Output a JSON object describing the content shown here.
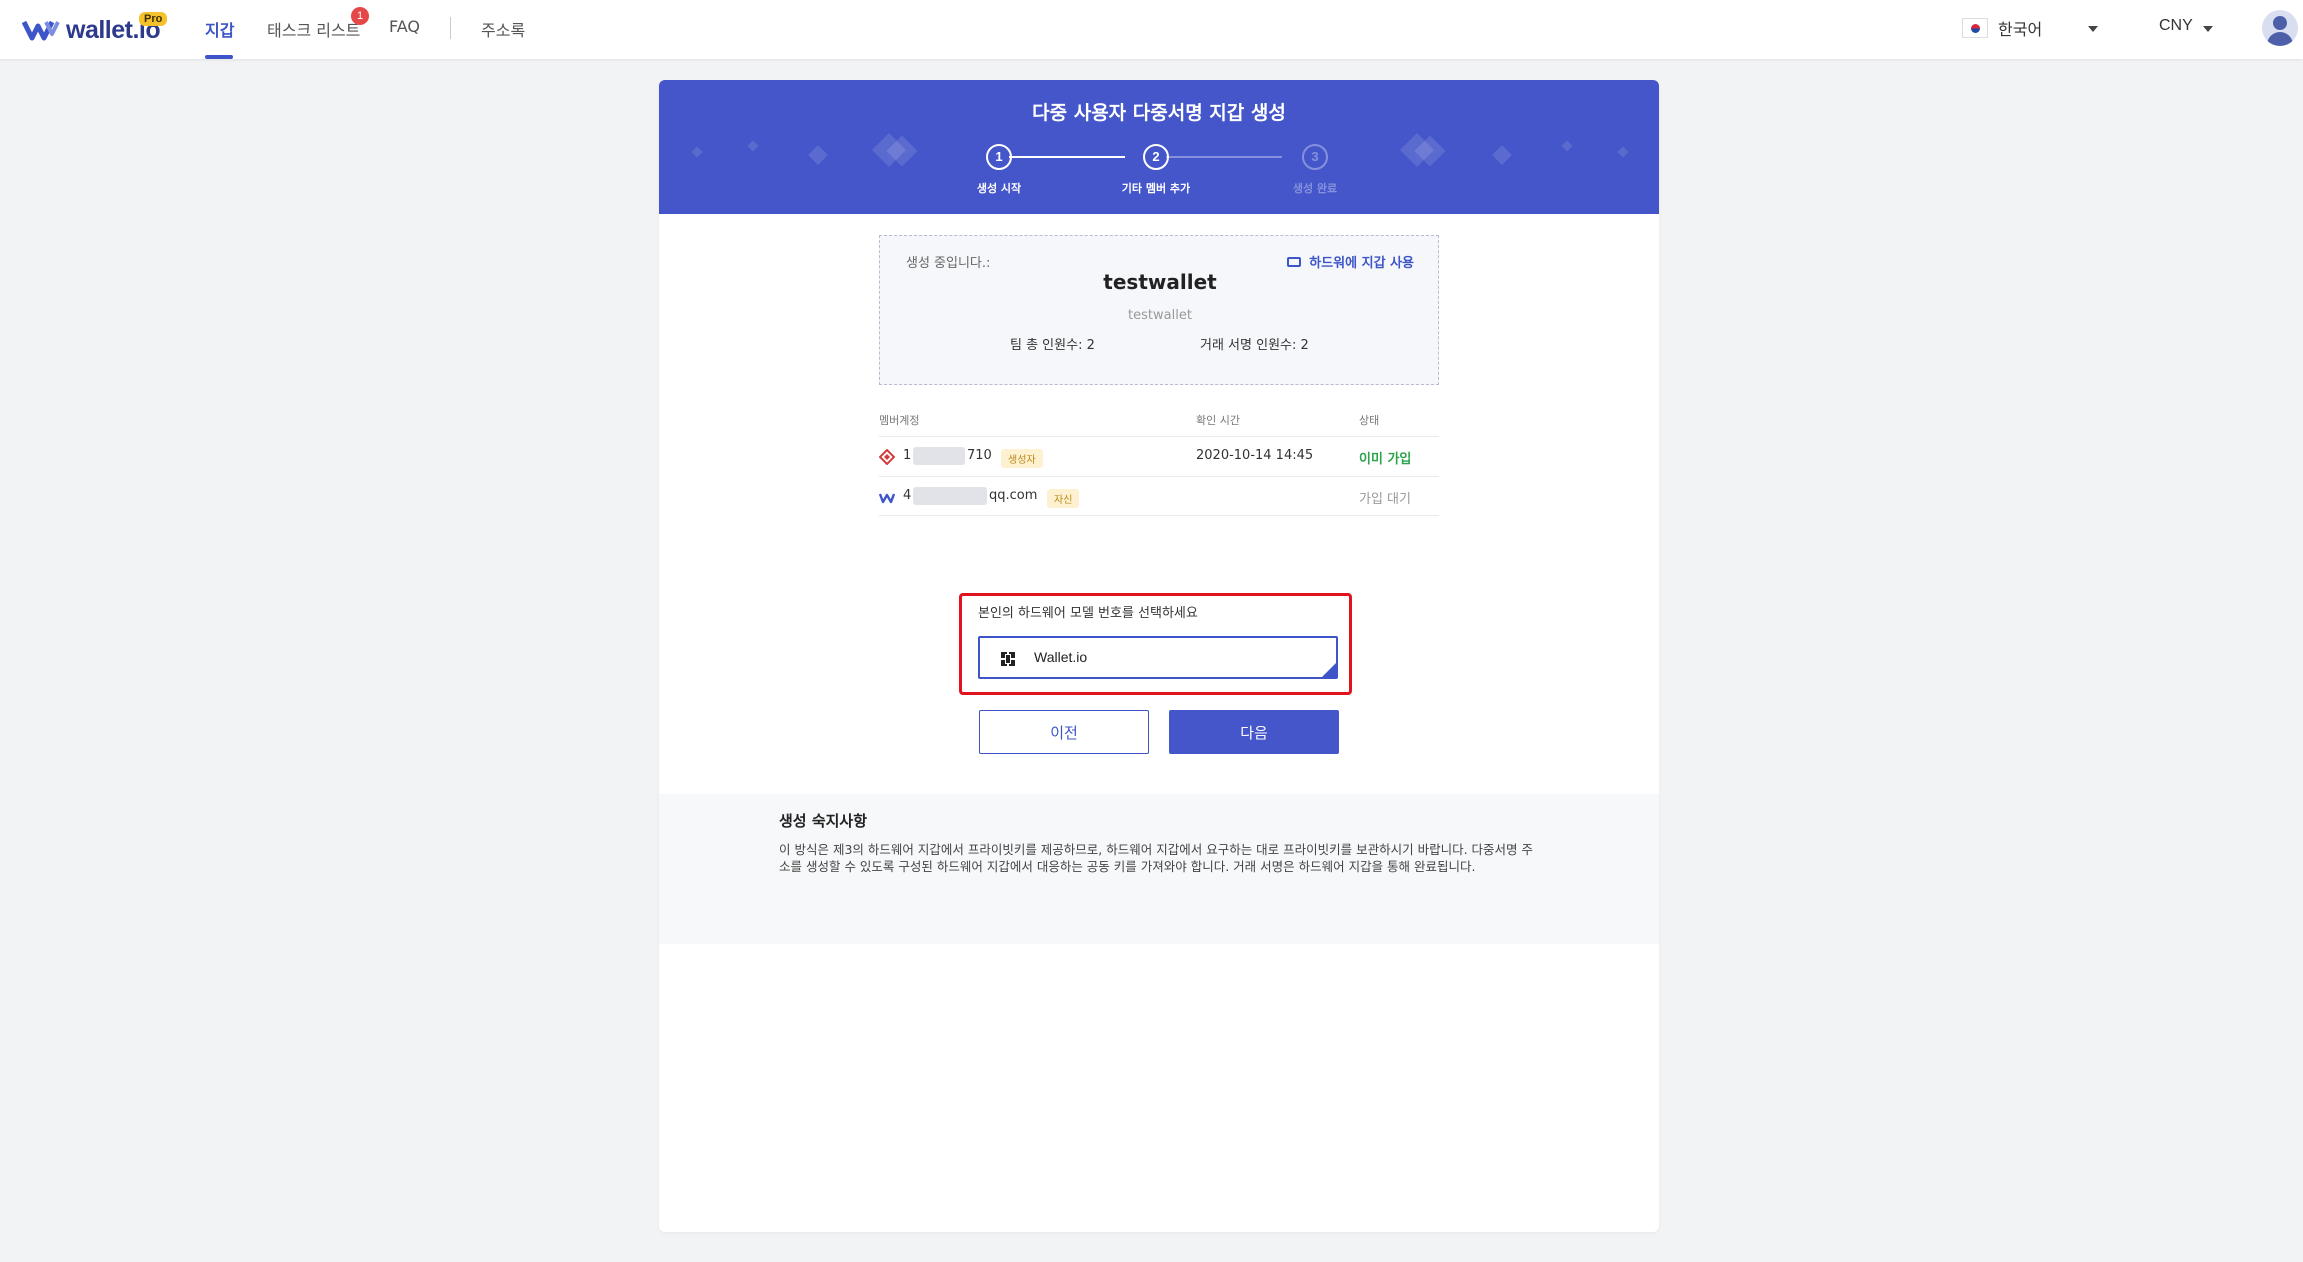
{
  "app": {
    "logo_text": "wallet.io",
    "logo_badge": "Pro"
  },
  "nav": {
    "items": [
      {
        "label": "지갑",
        "active": true
      },
      {
        "label": "태스크 리스트",
        "badge": "1"
      },
      {
        "label": "FAQ"
      },
      {
        "label": "주소록"
      }
    ],
    "language": "한국어",
    "currency": "CNY",
    "accent_color": "#3d55c8",
    "badge_color": "#e54848"
  },
  "banner": {
    "title": "다중 사용자 다중서명 지갑 생성",
    "color": "#4456c9",
    "steps": [
      {
        "number": "1",
        "label": "생성 시작",
        "state": "done"
      },
      {
        "number": "2",
        "label": "기타 멤버 추가",
        "state": "current"
      },
      {
        "number": "3",
        "label": "생성 완료",
        "state": "pending"
      }
    ]
  },
  "wallet_info": {
    "status_label": "생성 중입니다.:",
    "hardware_link": "하드워에 지갑 사용",
    "name": "testwallet",
    "subname": "testwallet",
    "team_total": "팀 총 인원수: 2",
    "sign_total": "거래 서명 인원수: 2"
  },
  "members_table": {
    "headers": [
      "멤버계정",
      "확인 시간",
      "상태"
    ],
    "rows": [
      {
        "account_start": "1",
        "account_end": "710",
        "tag": "생성자",
        "time": "2020-10-14 14:45",
        "status": "이미 가입",
        "status_type": "ok",
        "icon": "hardware-wallet-icon"
      },
      {
        "account_start": "4",
        "account_end": "qq.com",
        "tag": "자신",
        "time": "",
        "status": "가입 대기",
        "status_type": "wait",
        "icon": "walletio-icon"
      }
    ]
  },
  "hardware_select": {
    "label": "본인의 하드웨어 모델 번호를 선택하세요",
    "value": "Wallet.io",
    "highlight_color": "#e0141e"
  },
  "buttons": {
    "prev": "이전",
    "next": "다음"
  },
  "notes": {
    "title": "생성 숙지사항",
    "body": "이 방식은 제3의 하드웨어 지갑에서 프라이빗키를 제공하므로, 하드웨어 지갑에서 요구하는 대로 프라이빗키를 보관하시기 바랍니다. 다중서명 주소를 생성할 수 있도록 구성된 하드웨어 지갑에서 대응하는 공동 키를 가져와야 합니다. 거래 서명은 하드웨어 지갑을 통해 완료됩니다."
  }
}
